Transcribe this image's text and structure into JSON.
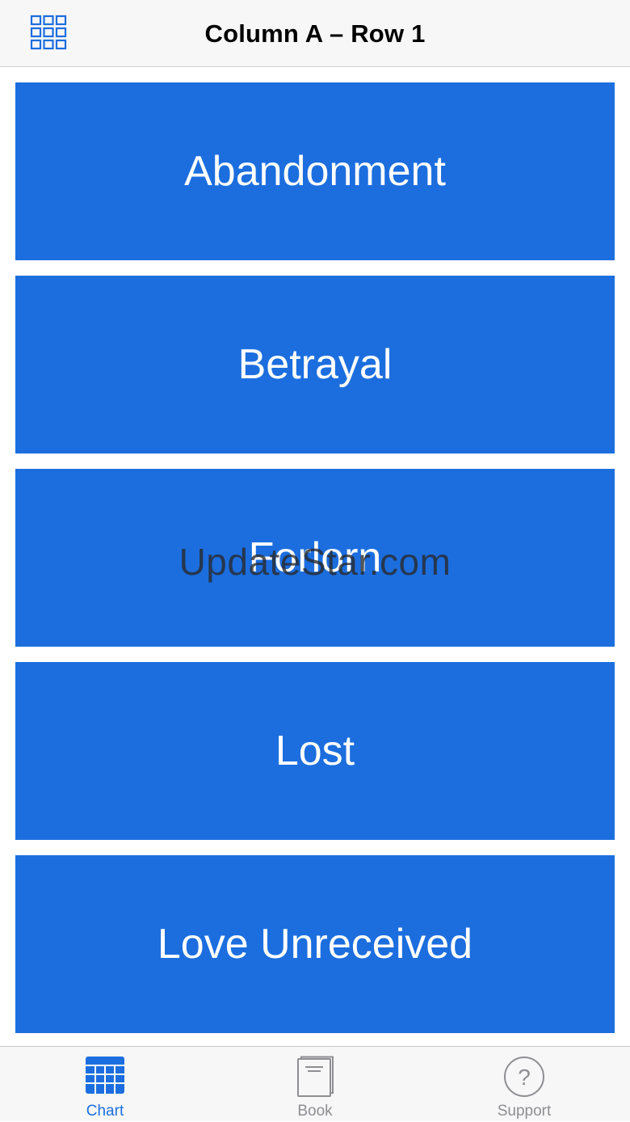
{
  "navbar": {
    "title": "Column A – Row 1",
    "grid_button_icon": "grid-icon"
  },
  "items": [
    {
      "label": "Abandonment"
    },
    {
      "label": "Betrayal"
    },
    {
      "label": "Forlorn"
    },
    {
      "label": "Lost"
    },
    {
      "label": "Love Unreceived"
    }
  ],
  "watermark": "UpdateStar.com",
  "tabbar": {
    "tabs": [
      {
        "label": "Chart",
        "icon": "chart-grid-icon",
        "selected": true
      },
      {
        "label": "Book",
        "icon": "book-icon",
        "selected": false
      },
      {
        "label": "Support",
        "icon": "question-circle-icon",
        "selected": false
      }
    ]
  },
  "colors": {
    "accent": "#1c6edf",
    "tile_text": "#ffffff",
    "inactive_tab": "#8e8e93",
    "bar_background": "#f7f7f7"
  }
}
